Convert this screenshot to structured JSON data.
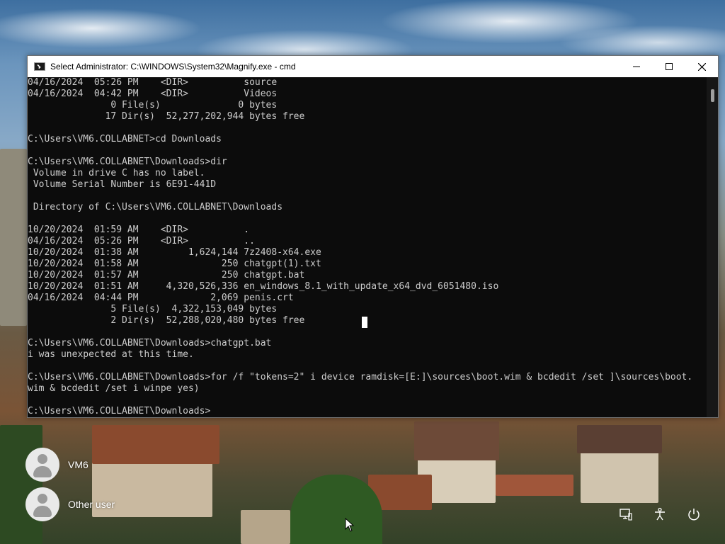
{
  "window": {
    "title": "Select Administrator: C:\\WINDOWS\\System32\\Magnify.exe - cmd",
    "icon": "console-icon",
    "controls": [
      "minimize-icon",
      "maximize-icon",
      "close-icon"
    ]
  },
  "console": {
    "lines": [
      "04/16/2024  05:26 PM    <DIR>          source",
      "04/16/2024  04:42 PM    <DIR>          Videos",
      "               0 File(s)              0 bytes",
      "              17 Dir(s)  52,277,202,944 bytes free",
      "",
      "C:\\Users\\VM6.COLLABNET>cd Downloads",
      "",
      "C:\\Users\\VM6.COLLABNET\\Downloads>dir",
      " Volume in drive C has no label.",
      " Volume Serial Number is 6E91-441D",
      "",
      " Directory of C:\\Users\\VM6.COLLABNET\\Downloads",
      "",
      "10/20/2024  01:59 AM    <DIR>          .",
      "04/16/2024  05:26 PM    <DIR>          ..",
      "10/20/2024  01:38 AM         1,624,144 7z2408-x64.exe",
      "10/20/2024  01:58 AM               250 chatgpt(1).txt",
      "10/20/2024  01:57 AM               250 chatgpt.bat",
      "10/20/2024  01:51 AM     4,320,526,336 en_windows_8.1_with_update_x64_dvd_6051480.iso",
      "04/16/2024  04:44 PM             2,069 penis.crt",
      "               5 File(s)  4,322,153,049 bytes",
      "               2 Dir(s)  52,288,020,480 bytes free",
      "",
      "C:\\Users\\VM6.COLLABNET\\Downloads>chatgpt.bat",
      "i was unexpected at this time.",
      "",
      "C:\\Users\\VM6.COLLABNET\\Downloads>for /f \"tokens=2\" i device ramdisk=[E:]\\sources\\boot.wim & bcdedit /set ]\\sources\\boot.",
      "wim & bcdedit /set i winpe yes)",
      "",
      "C:\\Users\\VM6.COLLABNET\\Downloads>"
    ]
  },
  "users": [
    {
      "name": "VM6",
      "icon": "user-avatar-icon"
    },
    {
      "name": "Other user",
      "icon": "user-avatar-icon"
    }
  ],
  "system_icons": [
    "network-icon",
    "accessibility-icon",
    "power-icon"
  ],
  "colors": {
    "console_bg": "#0c0c0c",
    "console_fg": "#cccccc",
    "titlebar_bg": "#ffffff"
  }
}
